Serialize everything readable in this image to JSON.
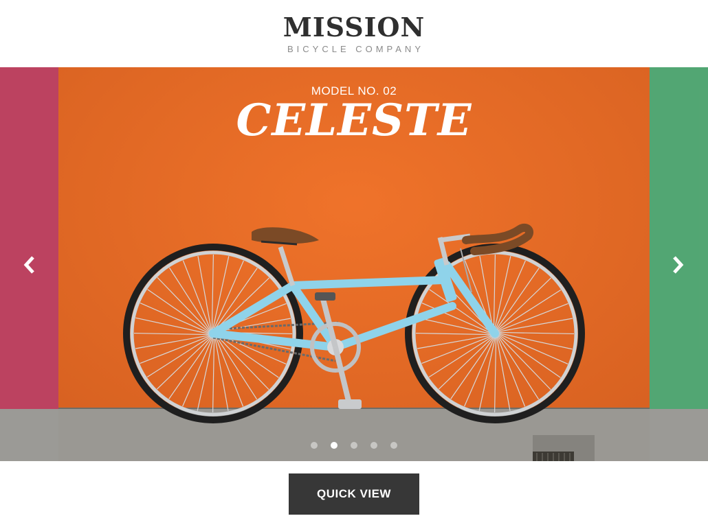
{
  "brand": {
    "title": "MISSION",
    "subtitle": "BICYCLE COMPANY"
  },
  "carousel": {
    "model_number": "MODEL NO. 02",
    "model_name": "CELESTE",
    "prev_icon": "chevron-left-icon",
    "next_icon": "chevron-right-icon",
    "slide_count": 5,
    "active_slide": 2,
    "colors": {
      "left_wall": "#b3284a",
      "main_wall": "#ea6a24",
      "right_wall": "#3b9a60",
      "bike_frame": "#8fd3ea"
    }
  },
  "actions": {
    "quick_view_label": "QUICK VIEW"
  }
}
